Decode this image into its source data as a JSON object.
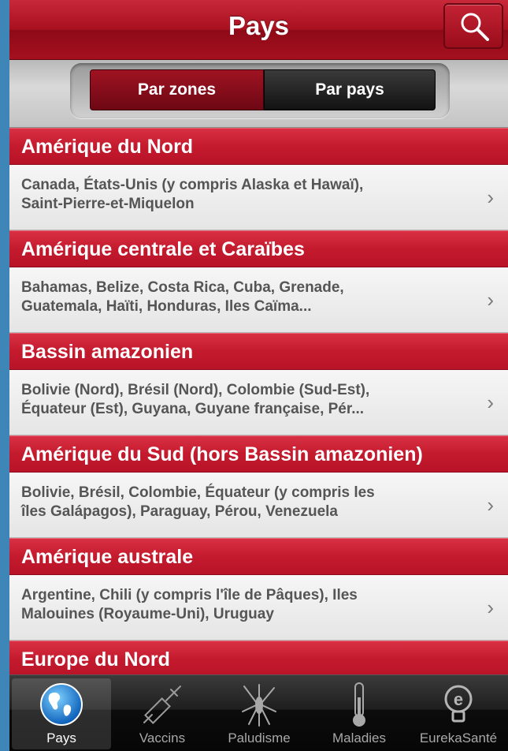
{
  "navbar": {
    "title": "Pays"
  },
  "segments": {
    "zones_label": "Par zones",
    "pays_label": "Par pays",
    "selected": "Par zones"
  },
  "sections": [
    {
      "header": "Amérique du Nord",
      "row_line1": "Canada, États-Unis (y compris Alaska et Hawaï),",
      "row_line2": "Saint-Pierre-et-Miquelon"
    },
    {
      "header": "Amérique centrale et Caraïbes",
      "row_line1": "Bahamas, Belize, Costa Rica, Cuba, Grenade,",
      "row_line2": "Guatemala, Haïti, Honduras, Iles Caïma..."
    },
    {
      "header": "Bassin amazonien",
      "row_line1": "Bolivie (Nord), Brésil (Nord), Colombie (Sud-Est),",
      "row_line2": "Équateur (Est), Guyana, Guyane française, Pér..."
    },
    {
      "header": "Amérique du Sud (hors Bassin amazonien)",
      "row_line1": "Bolivie, Brésil, Colombie, Équateur (y compris les",
      "row_line2": "îles Galápagos), Paraguay, Pérou, Venezuela"
    },
    {
      "header": "Amérique australe",
      "row_line1": "Argentine, Chili (y compris l'île de Pâques), Iles",
      "row_line2": "Malouines (Royaume-Uni), Uruguay"
    },
    {
      "header": "Europe du Nord"
    }
  ],
  "chevron": "›",
  "tabs": [
    {
      "label": "Pays",
      "icon": "globe-icon",
      "active": true
    },
    {
      "label": "Vaccins",
      "icon": "syringe-icon"
    },
    {
      "label": "Paludisme",
      "icon": "mosquito-icon"
    },
    {
      "label": "Maladies",
      "icon": "thermometer-icon"
    },
    {
      "label": "EurekaSanté",
      "icon": "eurekasante-logo-icon"
    }
  ],
  "colors": {
    "accent_red": "#c41a2e",
    "tabbar_bg": "#0c0c0c",
    "frame_blue": "#3f86b8"
  }
}
